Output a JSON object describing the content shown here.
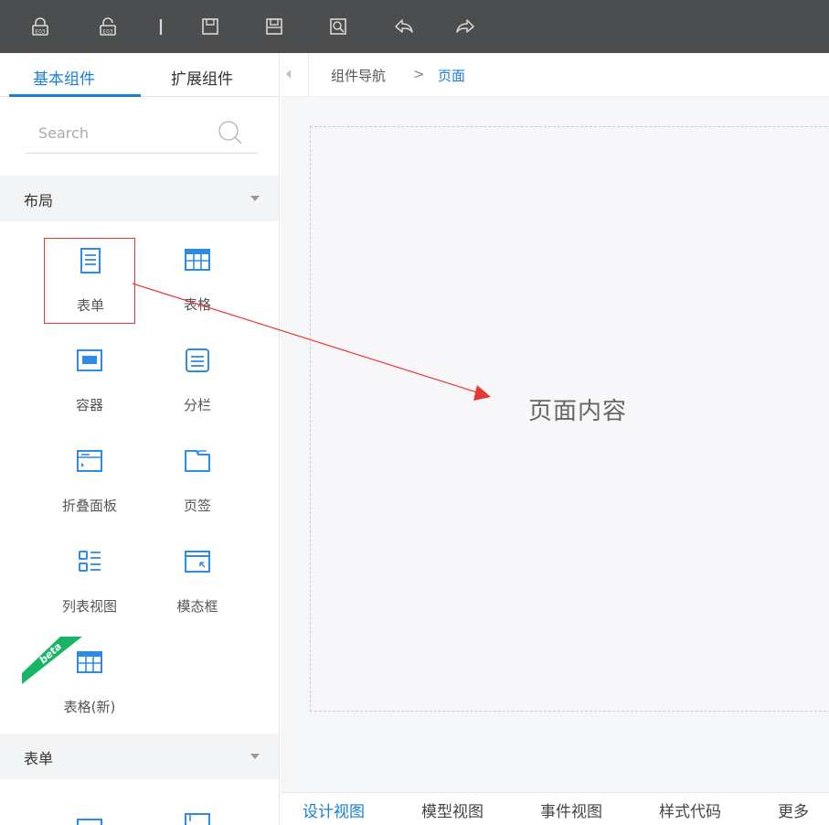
{
  "toolbar": {
    "icons": [
      "lock-icon",
      "unlock-icon",
      "divider-icon",
      "save-icon",
      "save-as-icon",
      "preview-icon",
      "undo-icon",
      "redo-icon"
    ]
  },
  "left_panel": {
    "tabs": [
      {
        "label": "基本组件",
        "active": true
      },
      {
        "label": "扩展组件",
        "active": false
      }
    ],
    "search_placeholder": "Search",
    "sections": [
      {
        "title": "布局",
        "items": [
          {
            "label": "表单",
            "icon": "form-icon",
            "highlighted": true
          },
          {
            "label": "表格",
            "icon": "table-icon"
          },
          {
            "label": "容器",
            "icon": "container-icon"
          },
          {
            "label": "分栏",
            "icon": "columns-icon"
          },
          {
            "label": "折叠面板",
            "icon": "collapse-panel-icon"
          },
          {
            "label": "页签",
            "icon": "tabs-icon"
          },
          {
            "label": "列表视图",
            "icon": "list-view-icon"
          },
          {
            "label": "模态框",
            "icon": "modal-icon"
          },
          {
            "label": "表格(新)",
            "icon": "table-new-icon",
            "badge": "beta"
          }
        ]
      },
      {
        "title": "表单",
        "items": []
      }
    ]
  },
  "breadcrumb": {
    "parent": "组件导航",
    "separator": ">",
    "current": "页面"
  },
  "canvas": {
    "placeholder": "页面内容"
  },
  "bottom_tabs": [
    {
      "label": "设计视图",
      "active": true
    },
    {
      "label": "模型视图",
      "active": false
    },
    {
      "label": "事件视图",
      "active": false
    },
    {
      "label": "样式代码",
      "active": false
    },
    {
      "label": "更多",
      "active": false
    }
  ],
  "colors": {
    "accent": "#1a7ed8",
    "toolbar_bg": "#4b4d4e",
    "annotation": "#e53935",
    "beta_badge": "#18b566"
  }
}
